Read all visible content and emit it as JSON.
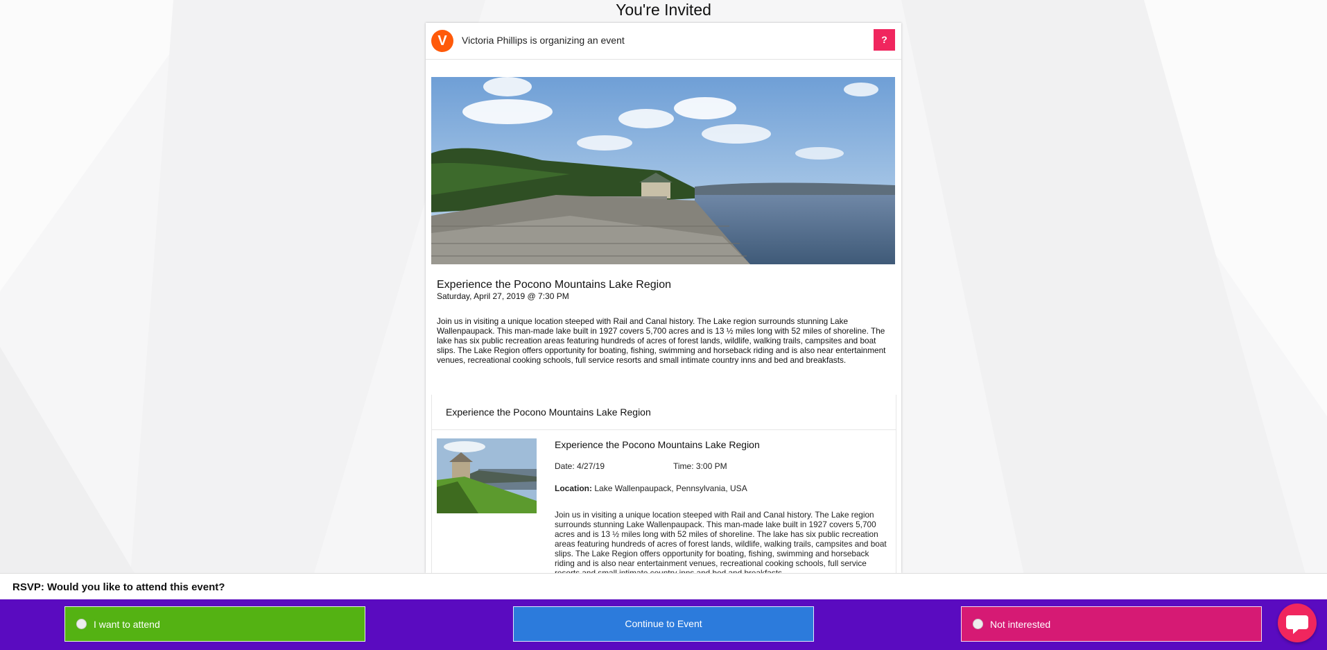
{
  "page": {
    "title": "You're Invited"
  },
  "organizer": {
    "avatar_letter": "V",
    "text": "Victoria Phillips is organizing an event",
    "help_label": "?"
  },
  "event": {
    "title": "Experience the Pocono Mountains Lake Region",
    "datetime": "Saturday, April 27, 2019 @ 7:30 PM",
    "description": "Join us in visiting a unique location steeped with Rail and Canal history. The Lake region surrounds stunning Lake Wallenpaupack. This man-made lake built in 1927 covers 5,700 acres and is 13 ½ miles long with 52 miles of shoreline. The lake has six public recreation areas featuring hundreds of acres of forest lands, wildlife, walking trails, campsites and boat slips. The Lake Region offers opportunity for boating, fishing, swimming and horseback riding and is also near entertainment venues, recreational cooking schools, full service resorts and small intimate country inns and bed and breakfasts."
  },
  "itinerary": {
    "header": "Experience the Pocono Mountains Lake Region",
    "item": {
      "title": "Experience the Pocono Mountains Lake Region",
      "date": "Date: 4/27/19",
      "time": "Time: 3:00 PM",
      "location_label": "Location:",
      "location_value": "Lake Wallenpaupack, Pennsylvania, USA",
      "description": "Join us in visiting a unique location steeped with Rail and Canal history. The Lake region surrounds stunning Lake Wallenpaupack. This man-made lake built in 1927 covers 5,700 acres and is 13 ½ miles long with 52 miles of shoreline. The lake has six public recreation areas featuring hundreds of acres of forest lands, wildlife, walking trails, campsites and boat slips. The Lake Region offers opportunity for boating, fishing, swimming and horseback riding and is also near entertainment venues, recreational cooking schools, full service resorts and small intimate country inns and bed and breakfasts."
    }
  },
  "rsvp": {
    "question": "RSVP: Would you like to attend this event?",
    "attend_label": "I want to attend",
    "continue_label": "Continue to Event",
    "not_interested_label": "Not interested"
  },
  "icons": {
    "chat": "chat-bubble-icon",
    "radio": "radio-icon"
  },
  "colors": {
    "accent_orange": "#ff5a0a",
    "help_pink": "#f0265e",
    "bar_purple": "#5a0bc0",
    "attend_green": "#54b213",
    "continue_blue": "#2c7bdc",
    "not_interested_magenta": "#d61a74"
  }
}
